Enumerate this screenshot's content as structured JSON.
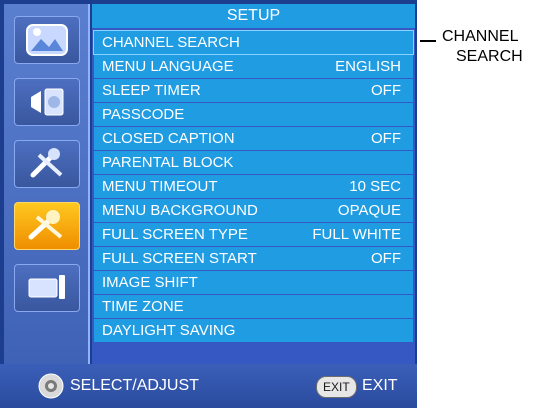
{
  "menu_title": "SETUP",
  "menu_items": [
    {
      "label": "CHANNEL SEARCH",
      "value": ""
    },
    {
      "label": "MENU LANGUAGE",
      "value": "ENGLISH"
    },
    {
      "label": "SLEEP TIMER",
      "value": "OFF"
    },
    {
      "label": "PASSCODE",
      "value": ""
    },
    {
      "label": "CLOSED CAPTION",
      "value": "OFF"
    },
    {
      "label": "PARENTAL BLOCK",
      "value": ""
    },
    {
      "label": "MENU TIMEOUT",
      "value": "10 SEC"
    },
    {
      "label": "MENU BACKGROUND",
      "value": "OPAQUE"
    },
    {
      "label": "FULL SCREEN TYPE",
      "value": "FULL WHITE"
    },
    {
      "label": "FULL SCREEN START",
      "value": "OFF"
    },
    {
      "label": "IMAGE SHIFT",
      "value": ""
    },
    {
      "label": "TIME ZONE",
      "value": ""
    },
    {
      "label": "DAYLIGHT SAVING",
      "value": ""
    }
  ],
  "sidebar_icons": [
    "picture-icon",
    "audio-icon",
    "tools-icon",
    "setup-icon",
    "display-icon"
  ],
  "footer": {
    "select_label": "SELECT/ADJUST",
    "exit_button": "EXIT",
    "exit_label": "EXIT"
  },
  "callout": {
    "line1": "CHANNEL",
    "line2": "SEARCH"
  },
  "colors": {
    "row": "#1f9ce2",
    "panel": "#3558c2",
    "active_icon": "#f5a30a"
  }
}
